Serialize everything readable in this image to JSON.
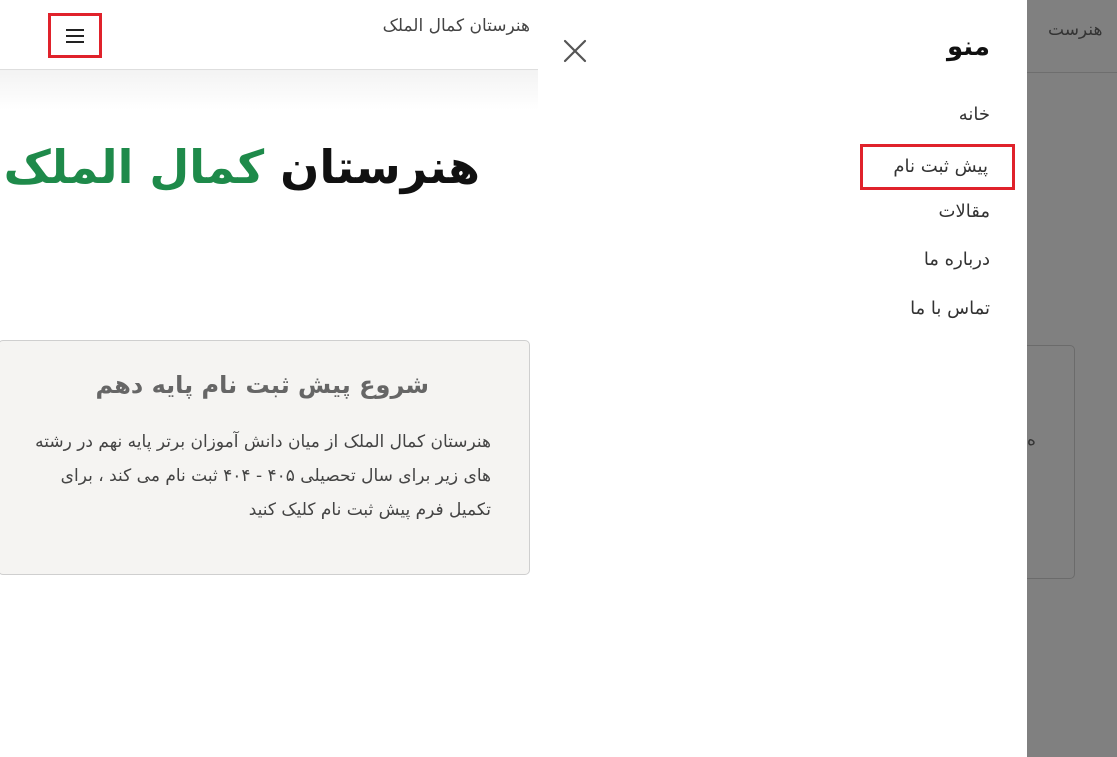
{
  "header": {
    "brand": "هنرستان کمال الملک",
    "menu_icon": "hamburger-menu-icon"
  },
  "hero": {
    "title_dark": "هنرستان",
    "title_green": "کمال الملک",
    "green_color": "#1e8a4a"
  },
  "card": {
    "title": "شروع پیش ثبت نام پایه دهم",
    "body": "هنرستان کمال الملک از میان دانش آموزان برتر پایه نهم در رشته های زیر برای سال تحصیلی ۴۰۵ - ۴۰۴ ثبت نام می کند ، برای تکمیل فرم پیش ثبت نام کلیک کنید"
  },
  "offcanvas": {
    "title": "منو",
    "close_icon": "close-icon",
    "items": [
      {
        "label": "خانه"
      },
      {
        "label": "پیش ثبت نام"
      },
      {
        "label": "مقالات"
      },
      {
        "label": "درباره ما"
      },
      {
        "label": "تماس با ما"
      }
    ]
  },
  "backdrop": {
    "header_fragment": "هنرست",
    "card_fragment": "ه"
  },
  "colors": {
    "highlight": "#e0222b",
    "backdrop": "#808080"
  }
}
